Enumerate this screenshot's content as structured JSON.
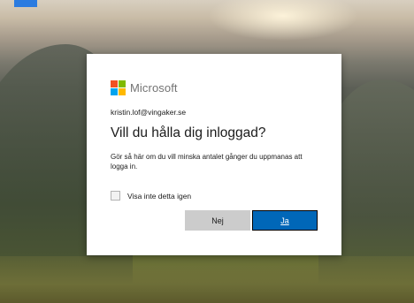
{
  "brand": {
    "name": "Microsoft",
    "logo_colors": [
      "#f25022",
      "#7fba00",
      "#00a4ef",
      "#ffb900"
    ]
  },
  "account": {
    "email": "kristin.lof@vingaker.se"
  },
  "prompt": {
    "title": "Vill du hålla dig inloggad?",
    "description": "Gör så här om du vill minska antalet gånger du uppmanas att logga in."
  },
  "options": {
    "dont_show_again_label": "Visa inte detta igen",
    "dont_show_again_checked": false
  },
  "actions": {
    "no_label": "Nej",
    "yes_label": "Ja"
  },
  "colors": {
    "primary_button": "#0067b8",
    "secondary_button": "#cccccc"
  }
}
